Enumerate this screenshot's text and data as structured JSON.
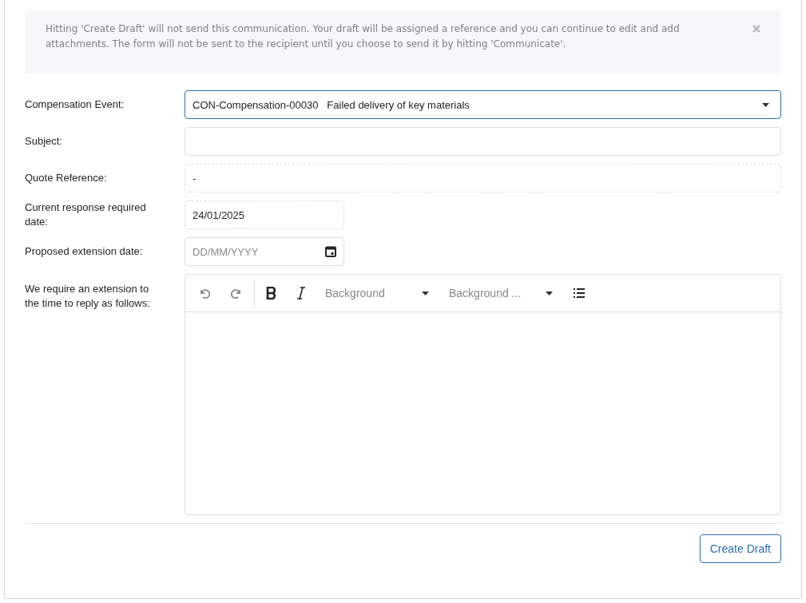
{
  "alert": {
    "text": "Hitting 'Create Draft' will not send this communication. Your draft will be assigned a reference and you can continue to edit and add attachments. The form will not be sent to the recipient until you choose to send it by hitting 'Communicate'."
  },
  "fields": [
    {
      "kind": "select",
      "label": "Compensation Event:",
      "value": "CON-Compensation-00030   Failed delivery of key materials"
    },
    {
      "kind": "text",
      "label": "Subject:"
    },
    {
      "kind": "readonly",
      "label": "Quote Reference:",
      "value": "-"
    },
    {
      "kind": "readonly-date",
      "label": "Current response required date:",
      "value": "24/01/2025"
    },
    {
      "kind": "date",
      "label": "Proposed extension date:",
      "placeholder": "DD/MM/YYYY"
    },
    {
      "kind": "editor",
      "label": "We require an extension to the time to reply as follows:",
      "toolbar_dropdowns": [
        "Background",
        "Background ..."
      ]
    }
  ],
  "submit": {
    "label": "Create Draft"
  }
}
